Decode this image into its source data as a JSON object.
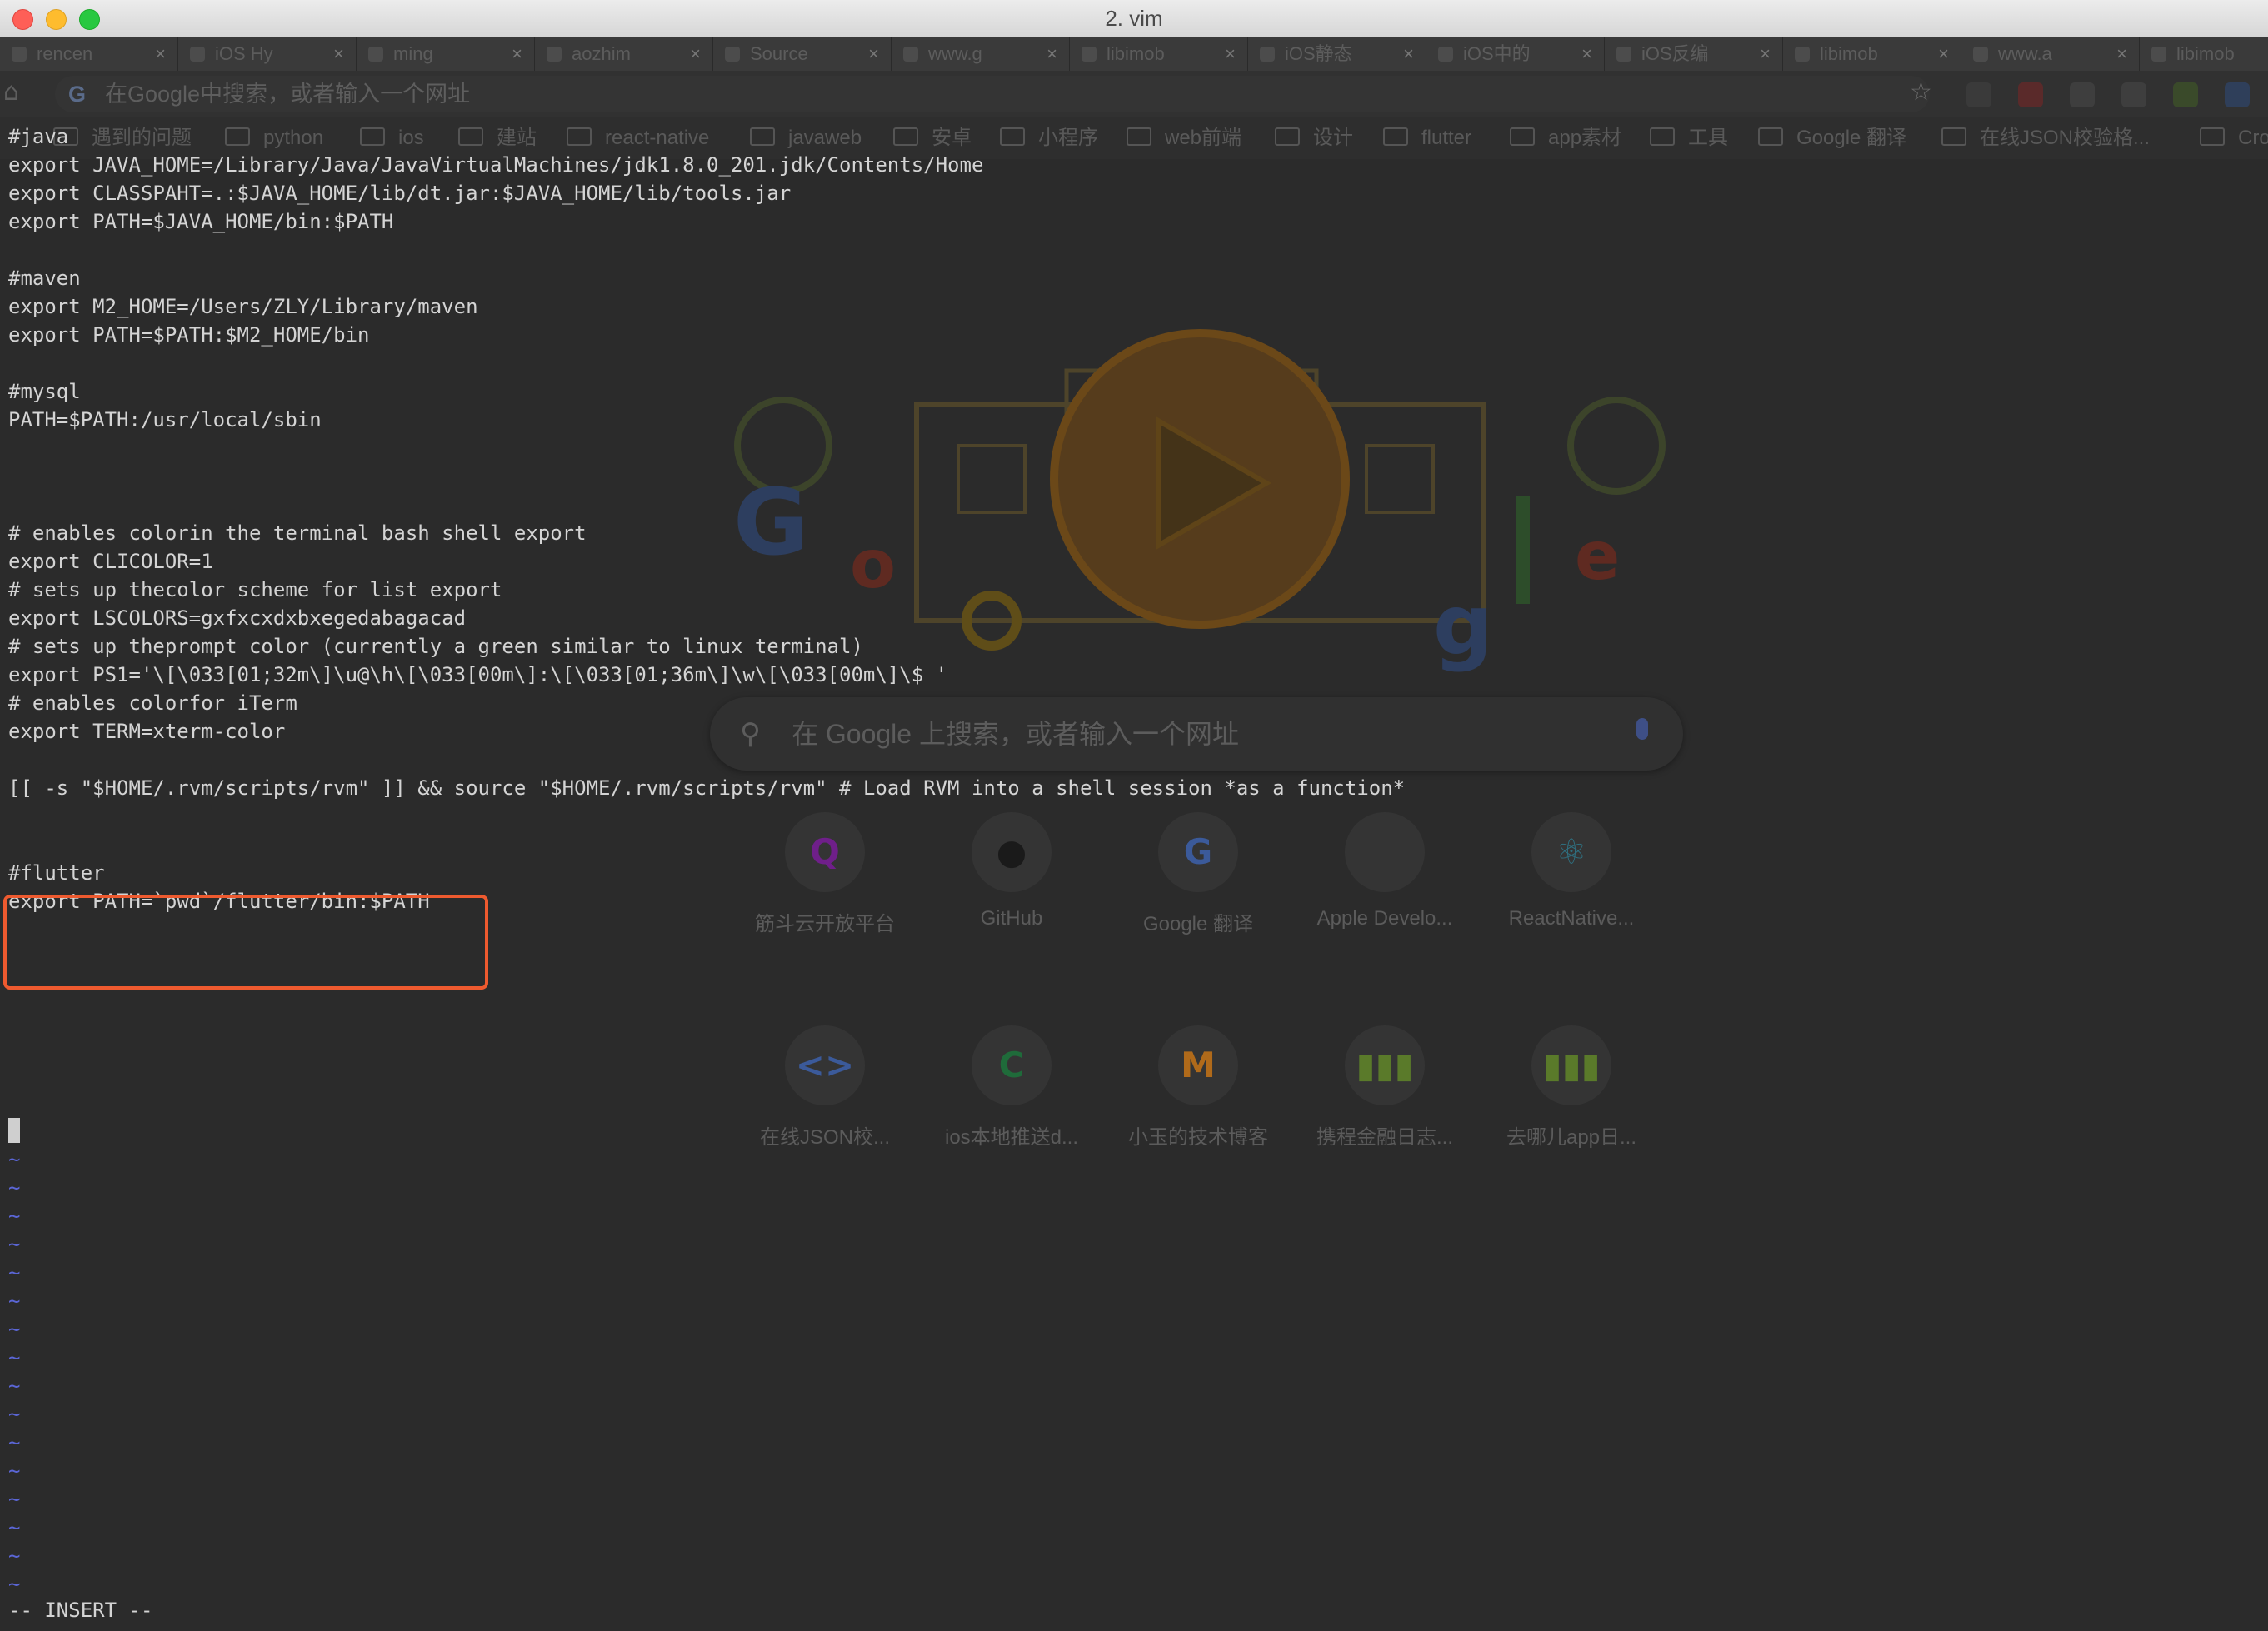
{
  "window": {
    "title": "2. vim"
  },
  "background_browser": {
    "tabs": [
      {
        "label": "rencen"
      },
      {
        "label": "iOS Hy"
      },
      {
        "label": "ming"
      },
      {
        "label": "aozhim"
      },
      {
        "label": "Source"
      },
      {
        "label": "www.g"
      },
      {
        "label": "libimob"
      },
      {
        "label": "iOS静态"
      },
      {
        "label": "iOS中的"
      },
      {
        "label": "iOS反编"
      },
      {
        "label": "libimob"
      },
      {
        "label": "www.a"
      },
      {
        "label": "libimob"
      }
    ],
    "omnibox_placeholder": "在Google中搜索，或者输入一个网址",
    "omnibox_g": "G",
    "bookmarks": [
      "遇到的问题",
      "python",
      "ios",
      "建站",
      "react-native",
      "javaweb",
      "安卓",
      "小程序",
      "web前端",
      "设计",
      "flutter",
      "app素材",
      "工具",
      "Google 翻译",
      "在线JSON校验格...",
      "Cro"
    ],
    "search_placeholder": "在 Google 上搜索，或者输入一个网址",
    "shortcuts": [
      {
        "label": "筋斗云开放平台",
        "glyph": "Q",
        "color": "#6f1f8a"
      },
      {
        "label": "GitHub",
        "glyph": "●",
        "color": "#1a1a1a"
      },
      {
        "label": "Google 翻译",
        "glyph": "G",
        "color": "#3b5a9a"
      },
      {
        "label": "Apple Develo...",
        "glyph": "",
        "color": "#555555"
      },
      {
        "label": "ReactNative...",
        "glyph": "⚛",
        "color": "#2f6f7f"
      },
      {
        "label": "在线JSON校...",
        "glyph": "<>",
        "color": "#3b5a9a"
      },
      {
        "label": "ios本地推送d...",
        "glyph": "C",
        "color": "#1f6b3a"
      },
      {
        "label": "小玉的技术博客",
        "glyph": "M",
        "color": "#b06a1a"
      },
      {
        "label": "携程金融日志...",
        "glyph": "▮▮▮",
        "color": "#5a7a2a"
      },
      {
        "label": "去哪儿app日...",
        "glyph": "▮▮▮",
        "color": "#5a7a2a"
      }
    ]
  },
  "vim": {
    "lines": [
      "#java",
      "export JAVA_HOME=/Library/Java/JavaVirtualMachines/jdk1.8.0_201.jdk/Contents/Home",
      "export CLASSPAHT=.:$JAVA_HOME/lib/dt.jar:$JAVA_HOME/lib/tools.jar",
      "export PATH=$JAVA_HOME/bin:$PATH",
      "",
      "#maven",
      "export M2_HOME=/Users/ZLY/Library/maven",
      "export PATH=$PATH:$M2_HOME/bin",
      "",
      "#mysql",
      "PATH=$PATH:/usr/local/sbin",
      "",
      "",
      "",
      "# enables colorin the terminal bash shell export",
      "export CLICOLOR=1",
      "# sets up thecolor scheme for list export",
      "export LSCOLORS=gxfxcxdxbxegedabagacad",
      "# sets up theprompt color (currently a green similar to linux terminal)",
      "export PS1='\\[\\033[01;32m\\]\\u@\\h\\[\\033[00m\\]:\\[\\033[01;36m\\]\\w\\[\\033[00m\\]\\$ '",
      "# enables colorfor iTerm",
      "export TERM=xterm-color",
      "",
      "[[ -s \"$HOME/.rvm/scripts/rvm\" ]] && source \"$HOME/.rvm/scripts/rvm\" # Load RVM into a shell session *as a function*",
      "",
      "",
      "#flutter",
      "export PATH=`pwd`/flutter/bin:$PATH"
    ],
    "tilde": "~",
    "tilde_count": 16,
    "mode": "-- INSERT --",
    "highlight_color": "#ee5a2f"
  }
}
